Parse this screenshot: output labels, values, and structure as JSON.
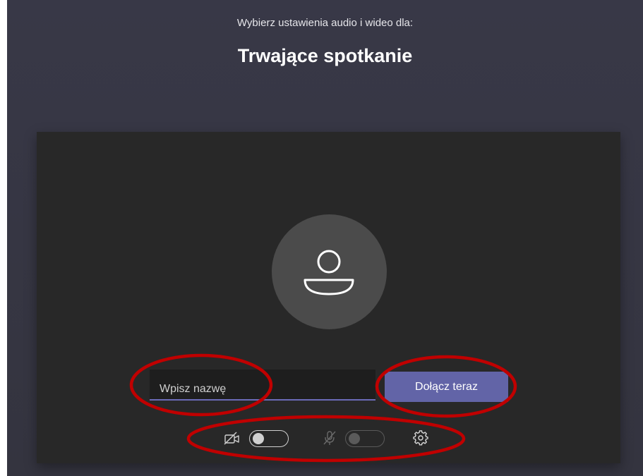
{
  "header": {
    "subtitle": "Wybierz ustawienia audio i wideo dla:",
    "meeting_title": "Trwające spotkanie"
  },
  "prejoin": {
    "name_input": {
      "placeholder": "Wpisz nazwę",
      "value": ""
    },
    "join_button_label": "Dołącz teraz"
  },
  "controls": {
    "camera": {
      "icon": "camera-off-icon",
      "enabled": false
    },
    "microphone": {
      "icon": "mic-off-icon",
      "enabled": false
    },
    "settings": {
      "icon": "gear-icon"
    }
  },
  "colors": {
    "background": "#383847",
    "preview_background": "#282828",
    "avatar_background": "#4b4b4b",
    "accent": "#6264a7",
    "annotation": "#c00000"
  }
}
